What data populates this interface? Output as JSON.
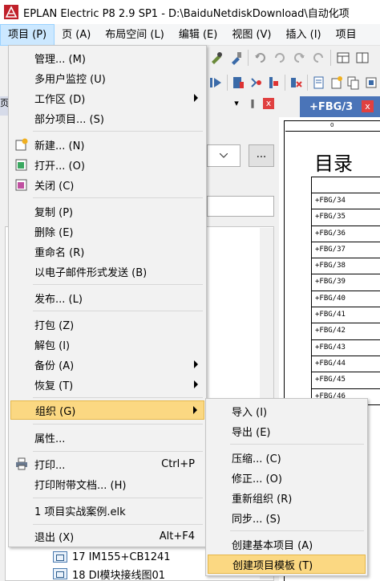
{
  "window": {
    "title": "EPLAN Electric P8 2.9 SP1 - D:\\BaiduNetdiskDownload\\自动化项"
  },
  "menubar": [
    "项目 (P)",
    "页 (A)",
    "布局空间 (L)",
    "编辑 (E)",
    "视图 (V)",
    "插入 (I)",
    "项目"
  ],
  "project_menu": {
    "groups": [
      [
        {
          "label": "管理... (M)"
        },
        {
          "label": "多用户监控 (U)"
        },
        {
          "label": "工作区 (D)",
          "submenu": true
        },
        {
          "label": "部分项目... (S)"
        }
      ],
      [
        {
          "label": "新建... (N)",
          "icon": "new-project-icon"
        },
        {
          "label": "打开... (O)",
          "icon": "open-project-icon"
        },
        {
          "label": "关闭 (C)",
          "icon": "close-project-icon"
        }
      ],
      [
        {
          "label": "复制 (P)"
        },
        {
          "label": "删除 (E)"
        },
        {
          "label": "重命名 (R)"
        },
        {
          "label": "以电子邮件形式发送 (B)"
        }
      ],
      [
        {
          "label": "发布... (L)"
        }
      ],
      [
        {
          "label": "打包 (Z)"
        },
        {
          "label": "解包 (I)"
        },
        {
          "label": "备份 (A)",
          "submenu": true
        },
        {
          "label": "恢复 (T)",
          "submenu": true
        }
      ],
      [
        {
          "label": "组织 (G)",
          "submenu": true,
          "highlighted": true
        }
      ],
      [
        {
          "label": "属性..."
        }
      ],
      [
        {
          "label": "打印...",
          "shortcut": "Ctrl+P",
          "icon": "printer-icon"
        },
        {
          "label": "打印附带文档... (H)"
        }
      ],
      [
        {
          "label": "1 项目实战案例.elk"
        }
      ],
      [
        {
          "label": "退出 (X)",
          "shortcut": "Alt+F4"
        }
      ]
    ]
  },
  "organize_submenu": {
    "groups": [
      [
        {
          "label": "导入 (I)"
        },
        {
          "label": "导出 (E)"
        }
      ],
      [
        {
          "label": "压缩... (C)"
        },
        {
          "label": "修正... (O)"
        },
        {
          "label": "重新组织 (R)"
        },
        {
          "label": "同步... (S)"
        }
      ],
      [
        {
          "label": "创建基本项目 (A)"
        },
        {
          "label": "创建项目模板 (T)",
          "highlighted": true
        }
      ]
    ]
  },
  "document": {
    "tab": "+FBG/3",
    "heading": "目录",
    "ruler_mark": "0",
    "rows": [
      "+FBG/34",
      "+FBG/35",
      "+FBG/36",
      "+FBG/37",
      "+FBG/38",
      "+FBG/39",
      "+FBG/40",
      "+FBG/41",
      "+FBG/42",
      "+FBG/43",
      "+FBG/44",
      "+FBG/45",
      "+FBG/46"
    ]
  },
  "panel": {
    "tab_letter": "页",
    "dots": "...",
    "ctrl_pin": "▾",
    "ctrl_dock": "‖",
    "ctrl_close": "x"
  },
  "tree": [
    "17 IM155+CB1241",
    "18 DI模块接线图01"
  ],
  "colors": {
    "highlight": "#fbd882",
    "active_menu": "#cce8ff",
    "tab_blue": "#4a74b8"
  }
}
